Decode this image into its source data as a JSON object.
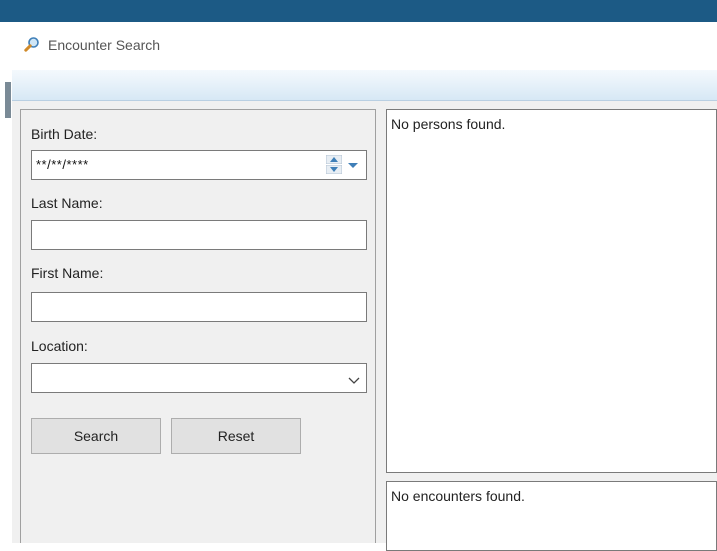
{
  "window": {
    "title": "Encounter Search",
    "icon": "search-icon",
    "accent": "#1c5a85"
  },
  "form": {
    "birth_date": {
      "label": "Birth Date:",
      "value": "**/**/****"
    },
    "last_name": {
      "label": "Last Name:",
      "value": ""
    },
    "first_name": {
      "label": "First Name:",
      "value": ""
    },
    "location": {
      "label": "Location:",
      "selected": ""
    }
  },
  "buttons": {
    "search": "Search",
    "reset": "Reset"
  },
  "results": {
    "persons_message": "No persons found.",
    "encounters_message": "No encounters found."
  }
}
